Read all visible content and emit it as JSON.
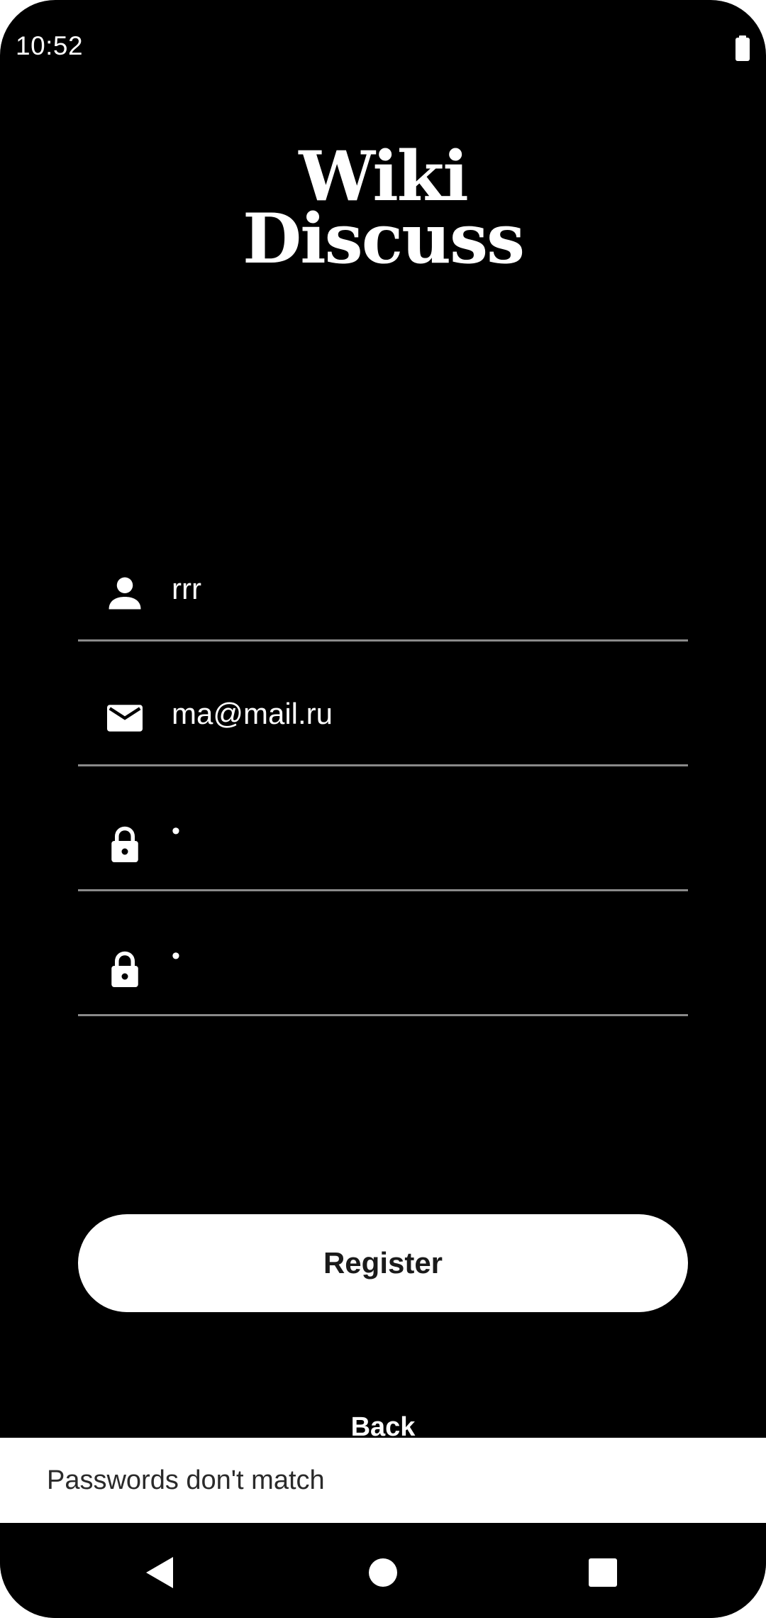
{
  "status_bar": {
    "time": "10:52",
    "battery_icon": "battery-full-icon"
  },
  "logo": {
    "line1": "Wiki",
    "line2": "Discuss"
  },
  "form": {
    "name": {
      "icon": "person-icon",
      "value": "rrr"
    },
    "email": {
      "icon": "mail-icon",
      "value": "ma@mail.ru"
    },
    "password": {
      "icon": "lock-icon",
      "value": "•"
    },
    "confirm_password": {
      "icon": "lock-icon",
      "value": "•"
    }
  },
  "register_button": {
    "label": "Register"
  },
  "back_link": {
    "label": "Back"
  },
  "snackbar": {
    "message": "Passwords don't match"
  },
  "nav_bar": {
    "back_icon": "back-triangle-icon",
    "home_icon": "home-circle-icon",
    "recents_icon": "recents-square-icon"
  },
  "colors": {
    "background": "#000000",
    "foreground": "#ffffff",
    "divider": "#8a8a8a",
    "button_text": "#1a1a1a"
  }
}
